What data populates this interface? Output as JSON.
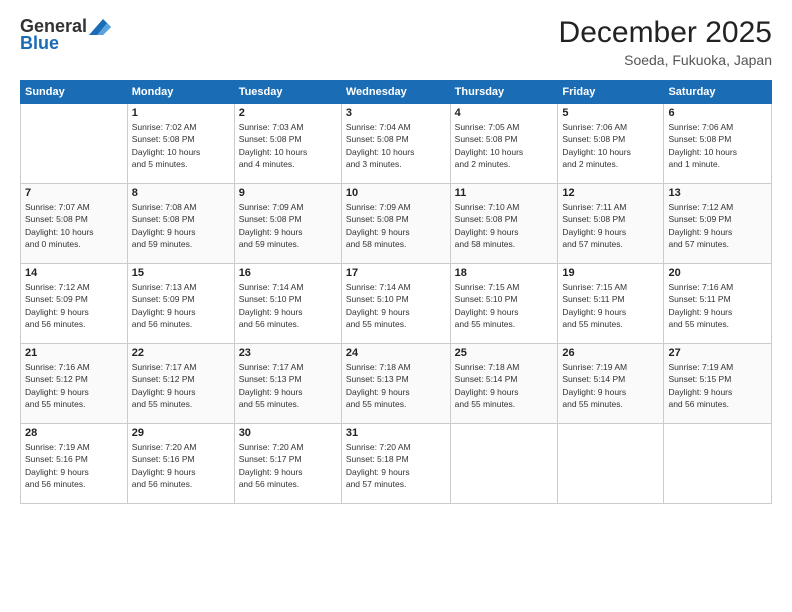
{
  "logo": {
    "line1": "General",
    "line2": "Blue"
  },
  "title": "December 2025",
  "location": "Soeda, Fukuoka, Japan",
  "columns": [
    "Sunday",
    "Monday",
    "Tuesday",
    "Wednesday",
    "Thursday",
    "Friday",
    "Saturday"
  ],
  "weeks": [
    [
      {
        "day": "",
        "info": ""
      },
      {
        "day": "1",
        "info": "Sunrise: 7:02 AM\nSunset: 5:08 PM\nDaylight: 10 hours\nand 5 minutes."
      },
      {
        "day": "2",
        "info": "Sunrise: 7:03 AM\nSunset: 5:08 PM\nDaylight: 10 hours\nand 4 minutes."
      },
      {
        "day": "3",
        "info": "Sunrise: 7:04 AM\nSunset: 5:08 PM\nDaylight: 10 hours\nand 3 minutes."
      },
      {
        "day": "4",
        "info": "Sunrise: 7:05 AM\nSunset: 5:08 PM\nDaylight: 10 hours\nand 2 minutes."
      },
      {
        "day": "5",
        "info": "Sunrise: 7:06 AM\nSunset: 5:08 PM\nDaylight: 10 hours\nand 2 minutes."
      },
      {
        "day": "6",
        "info": "Sunrise: 7:06 AM\nSunset: 5:08 PM\nDaylight: 10 hours\nand 1 minute."
      }
    ],
    [
      {
        "day": "7",
        "info": "Sunrise: 7:07 AM\nSunset: 5:08 PM\nDaylight: 10 hours\nand 0 minutes."
      },
      {
        "day": "8",
        "info": "Sunrise: 7:08 AM\nSunset: 5:08 PM\nDaylight: 9 hours\nand 59 minutes."
      },
      {
        "day": "9",
        "info": "Sunrise: 7:09 AM\nSunset: 5:08 PM\nDaylight: 9 hours\nand 59 minutes."
      },
      {
        "day": "10",
        "info": "Sunrise: 7:09 AM\nSunset: 5:08 PM\nDaylight: 9 hours\nand 58 minutes."
      },
      {
        "day": "11",
        "info": "Sunrise: 7:10 AM\nSunset: 5:08 PM\nDaylight: 9 hours\nand 58 minutes."
      },
      {
        "day": "12",
        "info": "Sunrise: 7:11 AM\nSunset: 5:08 PM\nDaylight: 9 hours\nand 57 minutes."
      },
      {
        "day": "13",
        "info": "Sunrise: 7:12 AM\nSunset: 5:09 PM\nDaylight: 9 hours\nand 57 minutes."
      }
    ],
    [
      {
        "day": "14",
        "info": "Sunrise: 7:12 AM\nSunset: 5:09 PM\nDaylight: 9 hours\nand 56 minutes."
      },
      {
        "day": "15",
        "info": "Sunrise: 7:13 AM\nSunset: 5:09 PM\nDaylight: 9 hours\nand 56 minutes."
      },
      {
        "day": "16",
        "info": "Sunrise: 7:14 AM\nSunset: 5:10 PM\nDaylight: 9 hours\nand 56 minutes."
      },
      {
        "day": "17",
        "info": "Sunrise: 7:14 AM\nSunset: 5:10 PM\nDaylight: 9 hours\nand 55 minutes."
      },
      {
        "day": "18",
        "info": "Sunrise: 7:15 AM\nSunset: 5:10 PM\nDaylight: 9 hours\nand 55 minutes."
      },
      {
        "day": "19",
        "info": "Sunrise: 7:15 AM\nSunset: 5:11 PM\nDaylight: 9 hours\nand 55 minutes."
      },
      {
        "day": "20",
        "info": "Sunrise: 7:16 AM\nSunset: 5:11 PM\nDaylight: 9 hours\nand 55 minutes."
      }
    ],
    [
      {
        "day": "21",
        "info": "Sunrise: 7:16 AM\nSunset: 5:12 PM\nDaylight: 9 hours\nand 55 minutes."
      },
      {
        "day": "22",
        "info": "Sunrise: 7:17 AM\nSunset: 5:12 PM\nDaylight: 9 hours\nand 55 minutes."
      },
      {
        "day": "23",
        "info": "Sunrise: 7:17 AM\nSunset: 5:13 PM\nDaylight: 9 hours\nand 55 minutes."
      },
      {
        "day": "24",
        "info": "Sunrise: 7:18 AM\nSunset: 5:13 PM\nDaylight: 9 hours\nand 55 minutes."
      },
      {
        "day": "25",
        "info": "Sunrise: 7:18 AM\nSunset: 5:14 PM\nDaylight: 9 hours\nand 55 minutes."
      },
      {
        "day": "26",
        "info": "Sunrise: 7:19 AM\nSunset: 5:14 PM\nDaylight: 9 hours\nand 55 minutes."
      },
      {
        "day": "27",
        "info": "Sunrise: 7:19 AM\nSunset: 5:15 PM\nDaylight: 9 hours\nand 56 minutes."
      }
    ],
    [
      {
        "day": "28",
        "info": "Sunrise: 7:19 AM\nSunset: 5:16 PM\nDaylight: 9 hours\nand 56 minutes."
      },
      {
        "day": "29",
        "info": "Sunrise: 7:20 AM\nSunset: 5:16 PM\nDaylight: 9 hours\nand 56 minutes."
      },
      {
        "day": "30",
        "info": "Sunrise: 7:20 AM\nSunset: 5:17 PM\nDaylight: 9 hours\nand 56 minutes."
      },
      {
        "day": "31",
        "info": "Sunrise: 7:20 AM\nSunset: 5:18 PM\nDaylight: 9 hours\nand 57 minutes."
      },
      {
        "day": "",
        "info": ""
      },
      {
        "day": "",
        "info": ""
      },
      {
        "day": "",
        "info": ""
      }
    ]
  ]
}
